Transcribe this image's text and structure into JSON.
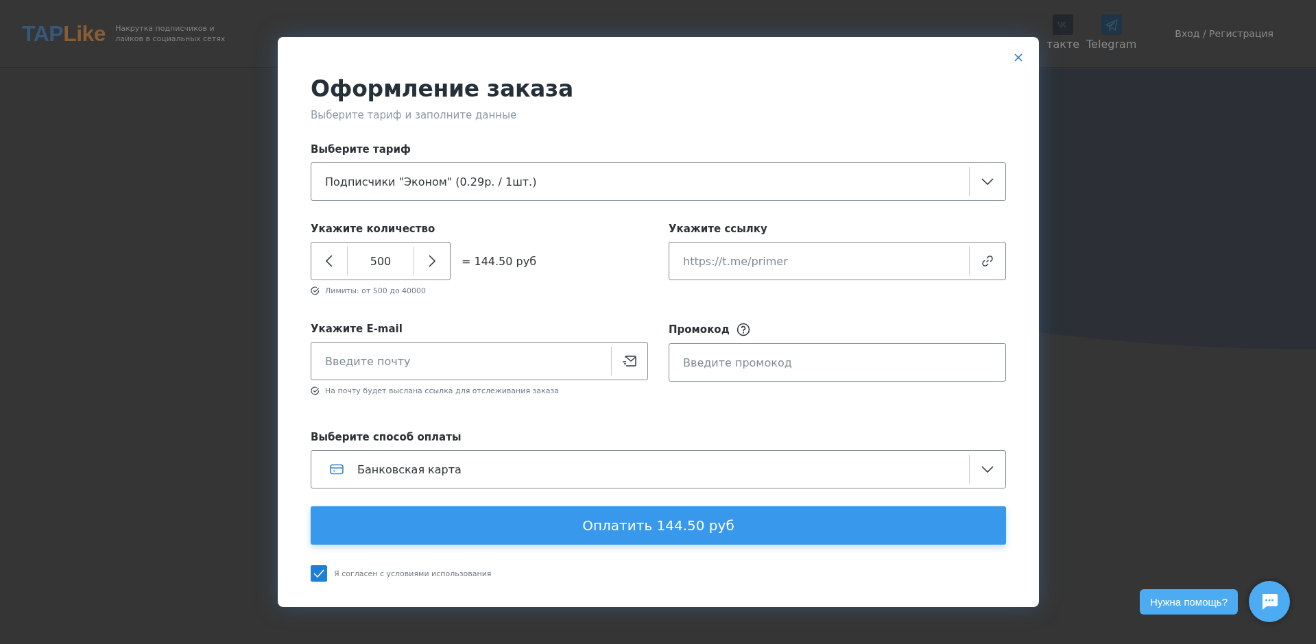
{
  "header": {
    "logo": {
      "part_1": "TAP",
      "part_2": "Like"
    },
    "tagline": "Накрутка подписчиков и лайков в социальных сетях",
    "nav": [
      {
        "kind": "vk",
        "label": "такте"
      },
      {
        "kind": "telegram",
        "label": "Telegram"
      }
    ],
    "login": "Вход / Регистрация"
  },
  "modal": {
    "title": "Оформление заказа",
    "subtitle": "Выберите тариф и заполните данные",
    "tariff": {
      "label": "Выберите тариф",
      "value": "Подписчики \"Эконом\" (0.29р. / 1шт.)"
    },
    "quantity": {
      "label": "Укажите количество",
      "value": "500",
      "total": "= 144.50 руб",
      "hint": "Лимиты: от 500 до 40000"
    },
    "link": {
      "label": "Укажите ссылку",
      "placeholder": "https://t.me/primer"
    },
    "email": {
      "label": "Укажите E-mail",
      "placeholder": "Введите почту",
      "hint": "На почту будет выслана ссылка для отслеживания заказа"
    },
    "promo": {
      "label": "Промокод",
      "placeholder": "Введите промокод"
    },
    "payment": {
      "label": "Выберите способ оплаты",
      "value": "Банковская карта"
    },
    "pay_button": "Оплатить 144.50 руб",
    "agree": {
      "label": "Я согласен с условиями использования",
      "checked": true
    }
  },
  "help": {
    "label": "Нужна помощь?"
  }
}
